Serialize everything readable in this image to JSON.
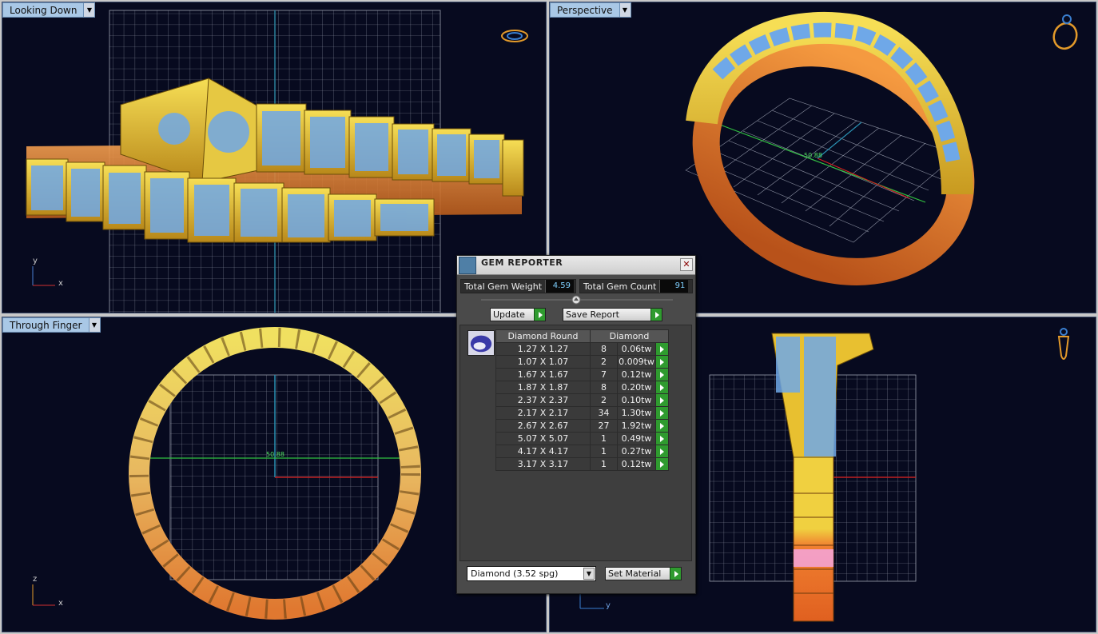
{
  "viewports": {
    "top_left": {
      "label": "Looking Down",
      "axis_v": "y",
      "axis_h": "x"
    },
    "top_right": {
      "label": "Perspective",
      "measure": "50.88"
    },
    "bottom_left": {
      "label": "Through Finger",
      "measure": "50.88",
      "axis_v": "z",
      "axis_h": "x"
    },
    "bottom_right": {
      "axis_h": "y"
    }
  },
  "gem_reporter": {
    "title": "GEM REPORTER",
    "close_label": "✕",
    "total_weight_label": "Total Gem Weight",
    "total_weight_value": "4.59",
    "total_count_label": "Total Gem Count",
    "total_count_value": "91",
    "update_label": "Update",
    "save_report_label": "Save Report",
    "table_headers": [
      "Diamond Round",
      "Diamond"
    ],
    "rows": [
      {
        "size": "1.27 X 1.27",
        "count": "8",
        "weight": "0.06tw"
      },
      {
        "size": "1.07 X 1.07",
        "count": "2",
        "weight": "0.009tw"
      },
      {
        "size": "1.67 X 1.67",
        "count": "7",
        "weight": "0.12tw"
      },
      {
        "size": "1.87 X 1.87",
        "count": "8",
        "weight": "0.20tw"
      },
      {
        "size": "2.37 X 2.37",
        "count": "2",
        "weight": "0.10tw"
      },
      {
        "size": "2.17 X 2.17",
        "count": "34",
        "weight": "1.30tw"
      },
      {
        "size": "2.67 X 2.67",
        "count": "27",
        "weight": "1.92tw"
      },
      {
        "size": "5.07 X 5.07",
        "count": "1",
        "weight": "0.49tw"
      },
      {
        "size": "4.17 X 4.17",
        "count": "1",
        "weight": "0.27tw"
      },
      {
        "size": "3.17 X 3.17",
        "count": "1",
        "weight": "0.12tw"
      }
    ],
    "material_select": "Diamond    (3.52 spg)",
    "set_material_label": "Set Material"
  },
  "colors": {
    "viewport_bg": "#070a1f",
    "grid": "#8a8fa0",
    "gold": "#e8c030",
    "rose": "#e07a30",
    "gem": "#6fa8e8"
  }
}
